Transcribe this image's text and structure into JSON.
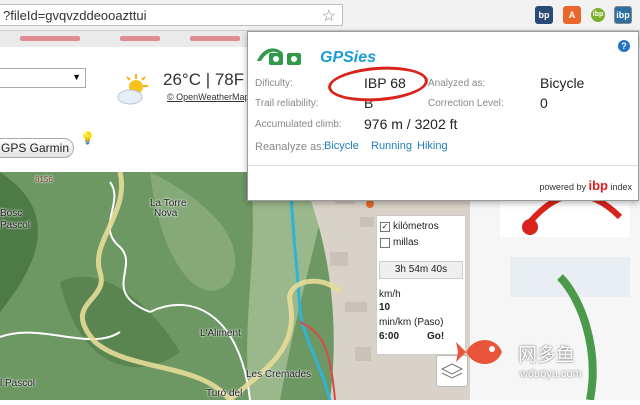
{
  "browser": {
    "url": "?fileId=gvqvzddeooazttui",
    "star_icon": "star-icon",
    "extensions": [
      {
        "name": "extension-icon-1",
        "label": "bp"
      },
      {
        "name": "extension-icon-2",
        "label": "A"
      },
      {
        "name": "extension-icon-3",
        "label": "ibp"
      },
      {
        "name": "extension-icon-ibp",
        "label": "ibp"
      }
    ]
  },
  "page": {
    "weather_temp": "26°C | 78F",
    "weather_link": "© OpenWeatherMap",
    "gps_button": "GPS Garmin"
  },
  "map": {
    "labels": [
      {
        "text": "8156"
      },
      {
        "text": "Bosc"
      },
      {
        "text": "Pascol"
      },
      {
        "text": "La Torre"
      },
      {
        "text": "Nova"
      },
      {
        "text": "L'Aliment"
      },
      {
        "text": "Les Cremades"
      },
      {
        "text": "l Pascol"
      },
      {
        "text": "Turó del"
      }
    ],
    "controls": {
      "kilometros": "kilómetros",
      "kilometros_checked": true,
      "millas": "millas",
      "millas_checked": false,
      "time": "3h 54m 40s",
      "speed_label": "km/h",
      "speed_value": "10",
      "pace_label": "min/km (Paso)",
      "pace_value": "6:00",
      "go": "Go!"
    }
  },
  "popup": {
    "brand": "GPSies",
    "difficulty_label": "Dificulty:",
    "difficulty_value": "IBP 68",
    "reliability_label": "Trail reliability:",
    "reliability_value": "B",
    "climb_label": "Accumulated climb:",
    "climb_value": "976 m / 3202 ft",
    "analyzed_label": "Analyzed as:",
    "analyzed_value": "Bicycle",
    "correction_label": "Correction Level:",
    "correction_value": "0",
    "reanalyze_label": "Reanalyze as:",
    "reanalyze_options": [
      "Bicycle",
      "Running",
      "Hiking"
    ],
    "powered_prefix": "powered by",
    "powered_brand": "ibp",
    "powered_suffix": "index",
    "help_icon": "help-icon"
  },
  "watermark": {
    "cn": "网多鱼",
    "en": "wduoyu.com"
  }
}
